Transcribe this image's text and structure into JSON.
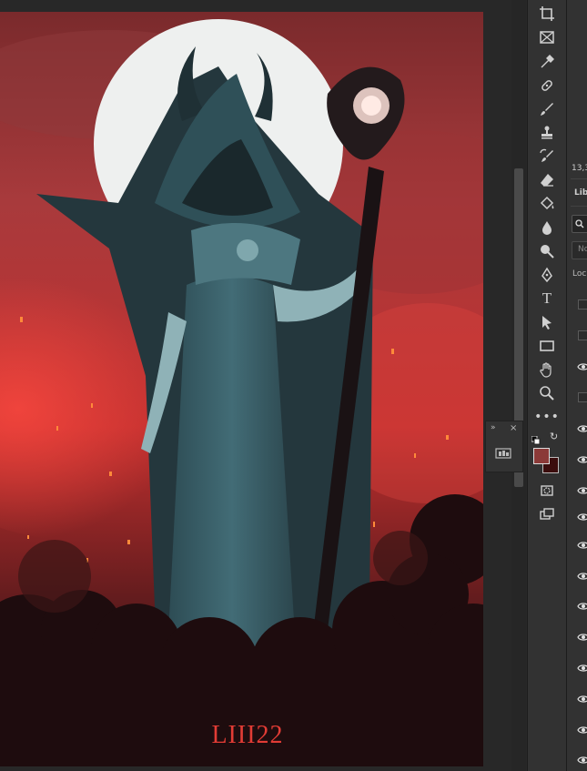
{
  "artwork": {
    "signature": "LIII22",
    "colors": {
      "sky": "#b8373a",
      "moon": "#eef0ef",
      "robe": "#3f6670",
      "crowd": "#1e0c0e",
      "glow": "#ff3b35"
    }
  },
  "panel": {
    "coords": "13,3",
    "tab_label": "Lib",
    "filter_placeholder": "No",
    "lock_label": "Lock"
  },
  "toolbar": {
    "tools": [
      "crop-icon",
      "frame-icon",
      "eyedropper-icon",
      "spot-healing-icon",
      "brush-icon",
      "stamp-icon",
      "history-brush-icon",
      "eraser-icon",
      "paint-bucket-icon",
      "blur-icon",
      "dodge-icon",
      "pen-icon",
      "type-icon",
      "path-selection-icon",
      "rectangle-icon",
      "hand-icon",
      "zoom-icon",
      "more-tools-icon"
    ],
    "type_glyph": "T",
    "foreground_color": "#8b3a38",
    "background_color": "#3b0d0d"
  }
}
